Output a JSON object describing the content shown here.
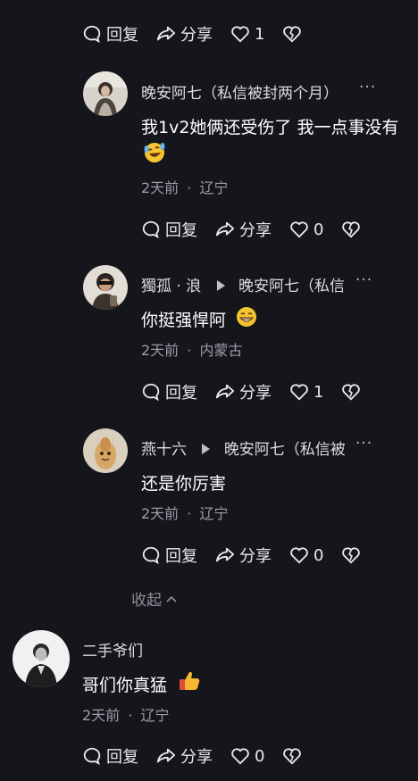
{
  "actions": {
    "reply": "回复",
    "share": "分享"
  },
  "top_actions": {
    "like_count": "1"
  },
  "reply1": {
    "name": "晚安阿七（私信被封两个月）",
    "more": "···",
    "text": "我1v2她俩还受伤了 我一点事没有",
    "time": "2天前",
    "sep": "·",
    "location": "辽宁",
    "like_count": "0"
  },
  "reply2": {
    "name": "獨孤 · 浪",
    "target": "晚安阿七（私信",
    "more": "···",
    "text": "你挺强悍阿",
    "time": "2天前",
    "sep": "·",
    "location": "内蒙古",
    "like_count": "1"
  },
  "reply3": {
    "name": "燕十六",
    "target": "晚安阿七（私信被",
    "more": "···",
    "text": "还是你厉害",
    "time": "2天前",
    "sep": "·",
    "location": "辽宁",
    "like_count": "0"
  },
  "collapse": {
    "label": "收起"
  },
  "comment4": {
    "name": "二手爷们",
    "text": "哥们你真猛",
    "time": "2天前",
    "sep": "·",
    "location": "辽宁",
    "like_count": "0"
  }
}
